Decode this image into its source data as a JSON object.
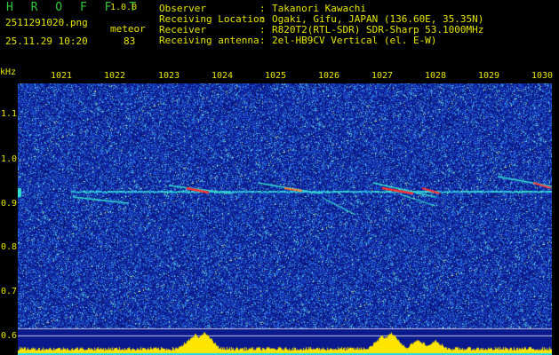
{
  "header": {
    "logo": "H R O F F T",
    "version": "1.0.0",
    "filename": "2511291020.png",
    "mode": "meteor",
    "datetime": "25.11.29 10:20",
    "count": "83",
    "info": [
      {
        "key": "Observer",
        "value": "Takanori Kawachi"
      },
      {
        "key": "Receiving Location",
        "value": "Ogaki, Gifu, JAPAN (136.60E, 35.35N)"
      },
      {
        "key": "Receiver",
        "value": "R820T2(RTL-SDR) SDR-Sharp 53.1000MHz"
      },
      {
        "key": "Receiving antenna",
        "value": "2el-HB9CV Vertical (el. E-W)"
      }
    ]
  },
  "axes": {
    "y_unit": "kHz",
    "x_ticks": [
      "1021",
      "1022",
      "1023",
      "1024",
      "1025",
      "1026",
      "1027",
      "1028",
      "1029",
      "1030"
    ],
    "y_ticks": [
      "1.1",
      "1.0",
      "0.9",
      "0.8",
      "0.7",
      "0.6"
    ]
  },
  "colors": {
    "text": "#e6e600",
    "logo": "#2fc83c",
    "noise_background": "#0a1a8c",
    "signal_line": "#33e0d0",
    "echo_hot": "#ff3030",
    "level_bar": "#ffe600"
  }
}
